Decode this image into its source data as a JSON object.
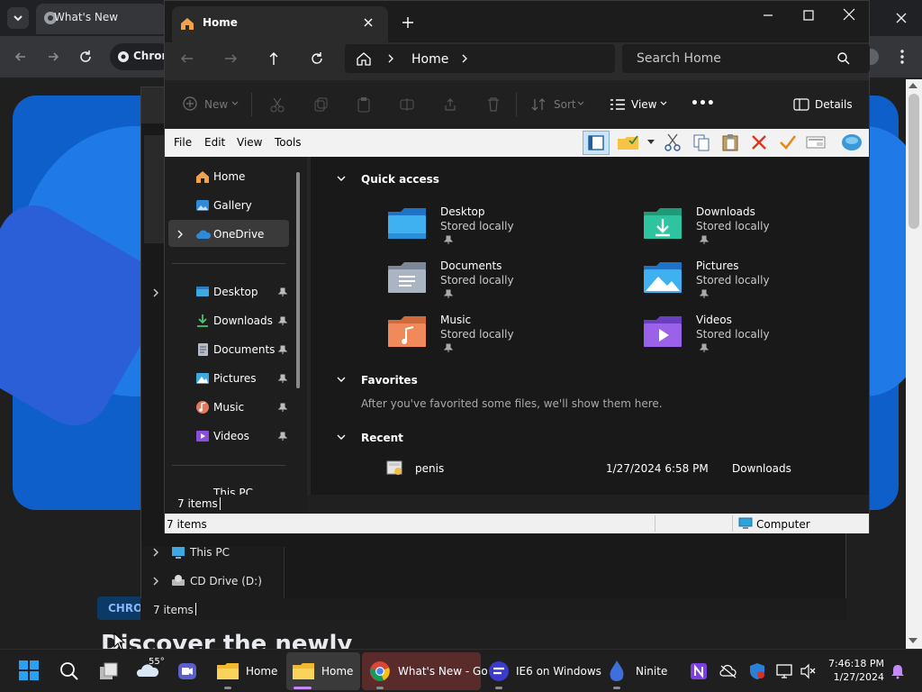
{
  "chrome": {
    "tab_title": "What's New",
    "omnibox_text": "Chrom",
    "badge": "CHRO",
    "heading": "Discover the newly"
  },
  "back_explorer": {
    "tree": [
      {
        "label": "This PC"
      },
      {
        "label": "CD Drive (D:)"
      }
    ],
    "items_count": "7 items"
  },
  "explorer": {
    "tab_title": "Home",
    "address": {
      "crumb": "Home"
    },
    "search_placeholder": "Search Home",
    "commands": {
      "new": "New",
      "sort": "Sort",
      "view": "View",
      "more": "•••",
      "details": "Details"
    },
    "menu": [
      "File",
      "Edit",
      "View",
      "Tools"
    ],
    "sidebar": {
      "top": [
        {
          "label": "Home"
        },
        {
          "label": "Gallery"
        },
        {
          "label": "OneDrive"
        }
      ],
      "pinned": [
        {
          "label": "Desktop"
        },
        {
          "label": "Downloads"
        },
        {
          "label": "Documents"
        },
        {
          "label": "Pictures"
        },
        {
          "label": "Music"
        },
        {
          "label": "Videos"
        }
      ],
      "partial": "This PC"
    },
    "sections": {
      "quick_access": "Quick access",
      "favorites": "Favorites",
      "favorites_empty": "After you've favorited some files, we'll show them here.",
      "recent": "Recent"
    },
    "quick_access": [
      {
        "name": "Desktop",
        "sub": "Stored locally"
      },
      {
        "name": "Downloads",
        "sub": "Stored locally"
      },
      {
        "name": "Documents",
        "sub": "Stored locally"
      },
      {
        "name": "Pictures",
        "sub": "Stored locally"
      },
      {
        "name": "Music",
        "sub": "Stored locally"
      },
      {
        "name": "Videos",
        "sub": "Stored locally"
      }
    ],
    "recent": [
      {
        "name": "penis",
        "date": "1/27/2024 6:58 PM",
        "location": "Downloads"
      }
    ],
    "items_count": "7 items",
    "status": {
      "items": "7 items",
      "zone": "Computer"
    }
  },
  "taskbar": {
    "weather": "55°",
    "apps": [
      {
        "label": "Home"
      },
      {
        "label": "Home"
      },
      {
        "label": "What's New - Go"
      },
      {
        "label": "IE6 on Windows"
      },
      {
        "label": "Ninite"
      }
    ],
    "time": "7:46:18 PM",
    "date": "1/27/2024"
  },
  "colors": {
    "accent": "#0078d4",
    "folder": "#f6c344",
    "selection": "#3a3a3a"
  }
}
